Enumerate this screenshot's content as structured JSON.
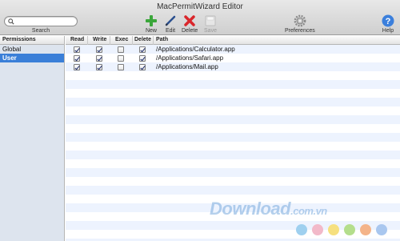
{
  "window": {
    "title": "MacPermitWizard Editor"
  },
  "toolbar": {
    "search_label": "Search",
    "search_placeholder": "",
    "new_label": "New",
    "edit_label": "Edit",
    "delete_label": "Delete",
    "save_label": "Save",
    "preferences_label": "Preferences",
    "help_label": "Help"
  },
  "sidebar": {
    "header": "Permissions",
    "items": [
      {
        "label": "Global",
        "selected": false
      },
      {
        "label": "User",
        "selected": true
      }
    ]
  },
  "table": {
    "columns": [
      "Read",
      "Write",
      "Exec",
      "Delete",
      "Path"
    ],
    "rows": [
      {
        "read": true,
        "write": true,
        "exec": false,
        "delete": true,
        "path": "/Applications/Calculator.app"
      },
      {
        "read": true,
        "write": true,
        "exec": false,
        "delete": true,
        "path": "/Applications/Safari.app"
      },
      {
        "read": true,
        "write": true,
        "exec": false,
        "delete": true,
        "path": "/Applications/Mail.app"
      }
    ]
  },
  "watermark": {
    "text": "Download",
    "suffix": ".com.vn"
  },
  "colors": {
    "selection": "#3a7fd8",
    "stripe": "#edf3fe",
    "new_icon": "#3aa63a",
    "delete_icon": "#d9262b",
    "help_icon": "#3b7fdc"
  },
  "icons": {
    "new": "plus-icon",
    "edit": "pencil-icon",
    "delete": "x-icon",
    "save": "disk-icon",
    "preferences": "gear-icon",
    "help": "question-icon"
  }
}
